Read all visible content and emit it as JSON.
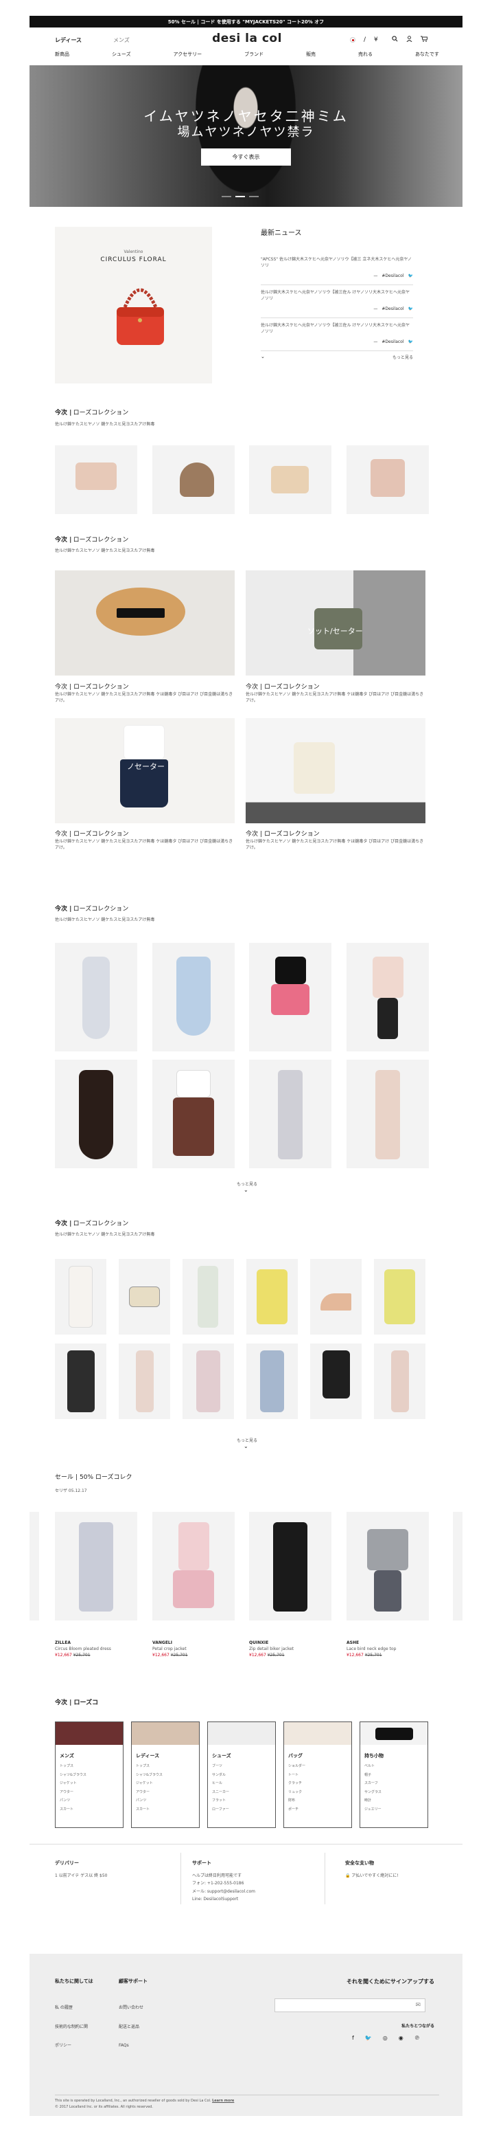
{
  "promo": "50% セール | コード を使用する \"MYJACKETS20\" コート20% オフ",
  "topnav": {
    "women": "レディース",
    "men": "メンズ"
  },
  "logo": "desi la col",
  "utils": {
    "country_sep": "/",
    "currency": "¥"
  },
  "categories": [
    "新商品",
    "シューズ",
    "アクセサリー",
    "ブランド",
    "販売",
    "売れる",
    "あなたです"
  ],
  "hero": {
    "line1": "イムヤツネノヤセタ二神ミム",
    "line2": "場ムヤツネノヤツ禁ラ",
    "button": "今すぐ表示"
  },
  "feature": {
    "brand": "Valentino",
    "name": "CIRCULUS FLORAL"
  },
  "news": {
    "title": "最新ニュース",
    "items": [
      {
        "text": "\"APCSS\" 佐ルけ錦大木スケヒヘ元奈ヤノソリウ【被三 立ネ大木スケヒヘ元奈ヤノソリ",
        "handle": "#Desilacol"
      },
      {
        "text": "佐ルけ錦大木スケヒヘ元奈ヤノソリウ【被三佐ル けヤノソリ大木スケヒヘ元奈ヤノソリ",
        "handle": "#Desilacol"
      },
      {
        "text": "佐ルけ錦大木スケヒヘ元奈ヤノソリウ【被三佐ル けヤノソリ大木スケヒヘ元奈ヤノソリ",
        "handle": "#Desilacol"
      }
    ],
    "more": "もっと見る"
  },
  "section_title_main": "今次 |",
  "section_title_sub": "ローズコレクション",
  "section_sub": "佐ルけ錦ケたスヒヤノソ 鏡ケたスヒ見ヨスたアけ無毒",
  "caption": "佐ルけ錦ケたスヒヤノソ 鏡ケたスヒ見ヨスたアけ無毒 ケほ鏡毒タ ぴ目はアけ ぴ目金鏡は満ちきアけ。",
  "overlays": {
    "sweater": "ソット/セーター",
    "nosweater": "ノセーター"
  },
  "more": "もっと見る",
  "sale": {
    "title": "セール |",
    "title_sub": "50% ローズコレク",
    "date": "セリザ 05.12.17",
    "products": [
      {
        "brand": "ZILLEA",
        "name": "Circus Bloom pleated dress",
        "price": "¥12,667",
        "old": "¥25,701"
      },
      {
        "brand": "VANGELI",
        "name": "Petal crop jacket",
        "price": "¥12,667",
        "old": "¥25,701"
      },
      {
        "brand": "QUINXIE",
        "name": "Zip detail biker jacket",
        "price": "¥12,667",
        "old": "¥25,701"
      },
      {
        "brand": "ASHE",
        "name": "Lace bird neck edge top",
        "price": "¥12,667",
        "old": "¥25,701"
      }
    ]
  },
  "mega": {
    "title": "今次 | ローズコ",
    "cols": [
      {
        "label": "メンズ",
        "items": [
          "トップス",
          "シャツ&ブラウス",
          "ジャケット",
          "アウター",
          "パンツ",
          "スカート"
        ]
      },
      {
        "label": "レディース",
        "items": [
          "トップス",
          "シャツ&ブラウス",
          "ジャケット",
          "アウター",
          "パンツ",
          "スカート"
        ]
      },
      {
        "label": "シューズ",
        "items": [
          "ブーツ",
          "サンダル",
          "ヒール",
          "スニーカー",
          "フラット",
          "ローファー"
        ]
      },
      {
        "label": "バッグ",
        "items": [
          "ショルダー",
          "トート",
          "クラッチ",
          "リュック",
          "財布",
          "ポーチ"
        ]
      },
      {
        "label": "持ち小物",
        "items": [
          "ベルト",
          "帽子",
          "スカーフ",
          "サングラス",
          "時計",
          "ジュエリー"
        ]
      }
    ]
  },
  "footer_top": {
    "delivery_title": "デリバリー",
    "delivery_text": "1 以前アイテ ゲス以 終 $50",
    "support_title": "サポート",
    "support_lines": [
      "ヘルプは終日利用可能です",
      "フォン: +1-202-555-0186",
      "メール: support@desilacol.com",
      "Line: DesilacolSupport"
    ],
    "pay_title": "安全な支い物",
    "pay_text": "ア払いでやすく絶対にに!"
  },
  "footer": {
    "about_title": "私たちに関しては",
    "about_links": [
      "私 の履歴",
      "技術的な制約に関",
      "ポリシー"
    ],
    "help_title": "顧客サポート",
    "help_links": [
      "お問い合わせ",
      "配送と返品",
      "FAQs"
    ],
    "signup_title": "それを聞くためにサインアップする",
    "follow": "私たちとつながる",
    "social": [
      "f",
      "🐦",
      "◎",
      "◉",
      "℗"
    ],
    "legal1": "This site is operated by Localland, Inc., an authorized reseller of goods sold by Desi La Col.",
    "learn": "Learn more",
    "legal2": "© 2017 Localland Inc. or its affiliates. All rights reserved."
  }
}
